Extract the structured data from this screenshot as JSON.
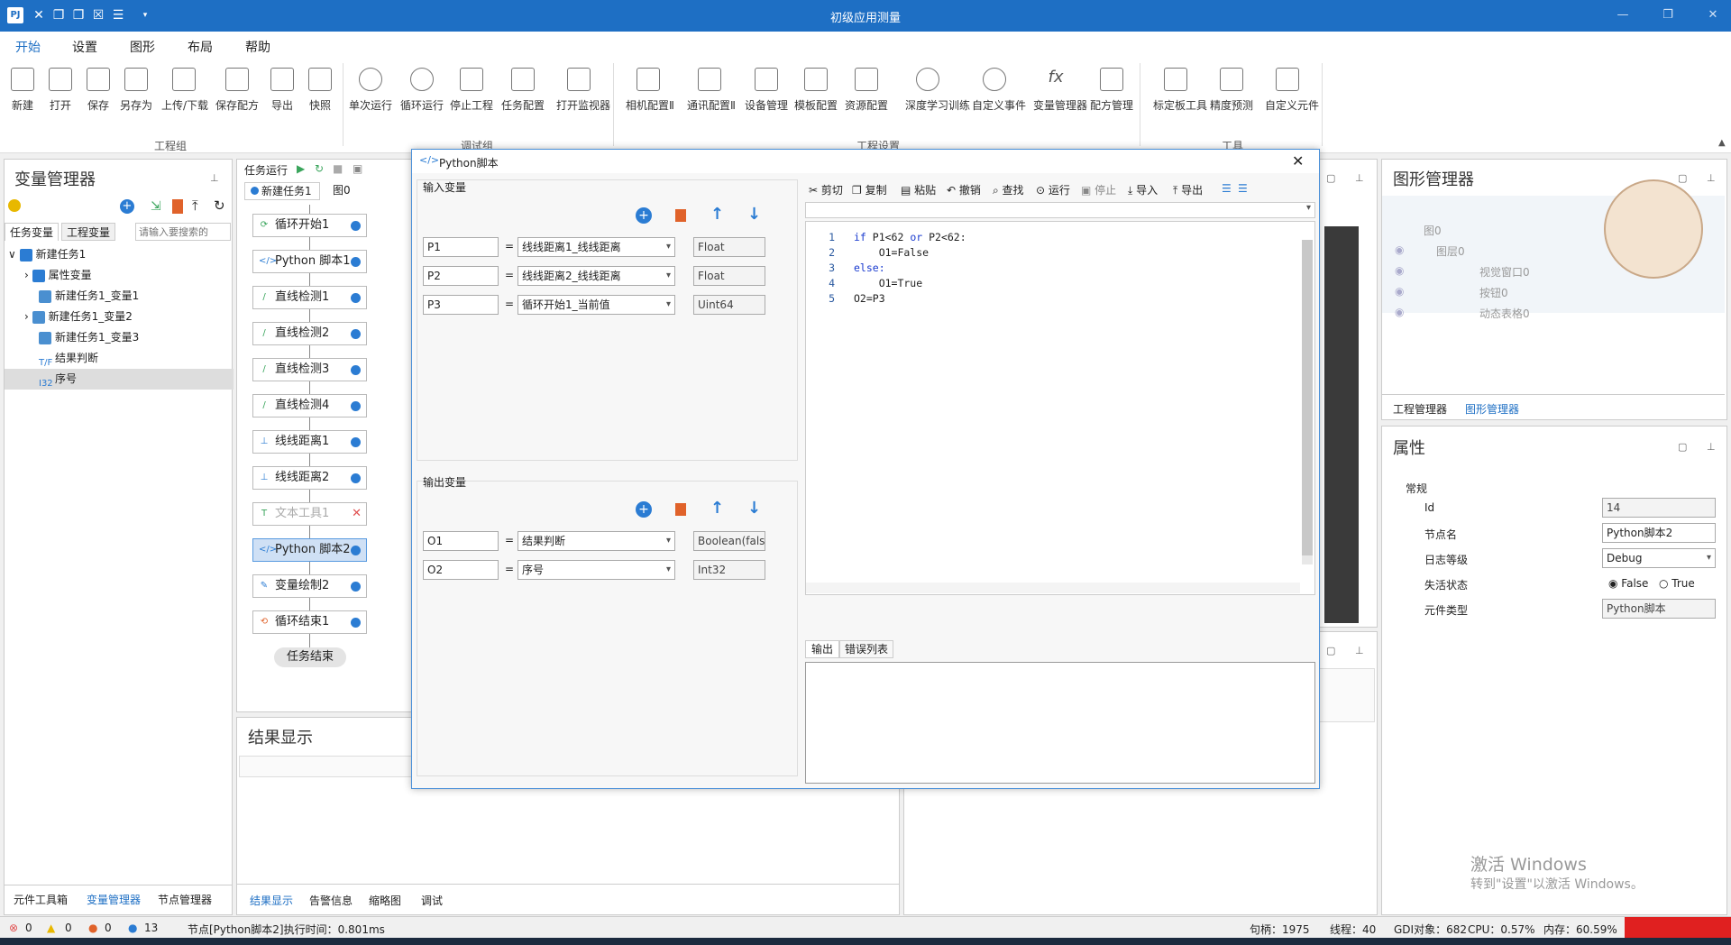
{
  "window": {
    "title": "初级应用测量"
  },
  "menu": [
    "开始",
    "设置",
    "图形",
    "布局",
    "帮助"
  ],
  "ribbon": {
    "buttons": [
      "新建",
      "打开",
      "保存",
      "另存为",
      "上传/下载",
      "保存配方",
      "导出",
      "快照",
      "单次运行",
      "循环运行",
      "停止工程",
      "任务配置",
      "打开监视器",
      "相机配置Ⅱ",
      "通讯配置Ⅱ",
      "设备管理",
      "模板配置",
      "资源配置",
      "深度学习训练",
      "自定义事件",
      "变量管理器",
      "配方管理",
      "标定板工具",
      "精度预测",
      "自定义元件"
    ],
    "groups": [
      "工程组",
      "调试组",
      "工程设置",
      "工具"
    ]
  },
  "var_manager": {
    "title": "变量管理器",
    "tabs": [
      "任务变量",
      "工程变量"
    ],
    "search_placeholder": "请输入要搜索的",
    "tree": [
      "新建任务1",
      "属性变量",
      "新建任务1_变量1",
      "新建任务1_变量2",
      "新建任务1_变量3",
      "结果判断",
      "序号"
    ],
    "bottom_tabs": [
      "元件工具箱",
      "变量管理器",
      "节点管理器"
    ]
  },
  "task": {
    "header": "任务运行",
    "tabs": [
      "新建任务1",
      "图0"
    ],
    "nodes": [
      "循环开始1",
      "Python 脚本1",
      "直线检测1",
      "直线检测2",
      "直线检测3",
      "直线检测4",
      "线线距离1",
      "线线距离2",
      "文本工具1",
      "Python 脚本2",
      "变量绘制2",
      "循环结束1"
    ],
    "end": "任务结束"
  },
  "results": {
    "title": "结果显示",
    "bottom_tabs": [
      "结果显示",
      "告警信息",
      "缩略图",
      "调试"
    ]
  },
  "dialog": {
    "title": "Python脚本",
    "input_title": "输入变量",
    "inputs": [
      {
        "name": "P1",
        "source": "线线距离1_线线距离",
        "type": "Float"
      },
      {
        "name": "P2",
        "source": "线线距离2_线线距离",
        "type": "Float"
      },
      {
        "name": "P3",
        "source": "循环开始1_当前值",
        "type": "Uint64"
      }
    ],
    "output_title": "输出变量",
    "outputs": [
      {
        "name": "O1",
        "source": "结果判断",
        "type": "Boolean(fals"
      },
      {
        "name": "O2",
        "source": "序号",
        "type": "Int32"
      }
    ],
    "toolbar": [
      "剪切",
      "复制",
      "粘贴",
      "撤销",
      "查找",
      "运行",
      "停止",
      "导入",
      "导出"
    ],
    "code": [
      "if P1<62 or P2<62:",
      "    O1=False",
      "else:",
      "    O1=True",
      "O2=P3"
    ],
    "code_numbers": [
      "1",
      "2",
      "3",
      "4",
      "5"
    ],
    "out_tabs": [
      "输出",
      "错误列表"
    ]
  },
  "graphics_manager": {
    "title": "图形管理器",
    "tree": [
      "图0",
      "图层0",
      "视觉窗口0",
      "按钮0",
      "动态表格0"
    ],
    "tabs": [
      "工程管理器",
      "图形管理器"
    ]
  },
  "properties": {
    "title": "属性",
    "section": "常规",
    "rows": [
      {
        "label": "Id",
        "value": "14"
      },
      {
        "label": "节点名",
        "value": "Python脚本2"
      },
      {
        "label": "日志等级",
        "value": "Debug"
      },
      {
        "label": "失活状态",
        "value": ""
      },
      {
        "label": "元件类型",
        "value": "Python脚本"
      }
    ],
    "radio_false": "False",
    "radio_true": "True"
  },
  "watermark": {
    "line1": "激活 Windows",
    "line2": "转到\"设置\"以激活 Windows。"
  },
  "status": {
    "err": "0",
    "warn": "0",
    "stop": "0",
    "info": "13",
    "message": "节点[Python脚本2]执行时间：0.801ms",
    "handles": "句柄：1975",
    "threads": "线程：40",
    "gdi": "GDI对象：682",
    "cpu": "CPU：0.57%",
    "mem": "内存：60.59%"
  },
  "colors": {
    "accent": "#1e6fc4",
    "node_dot": "#2b7cd3",
    "delete": "#e0622a"
  }
}
